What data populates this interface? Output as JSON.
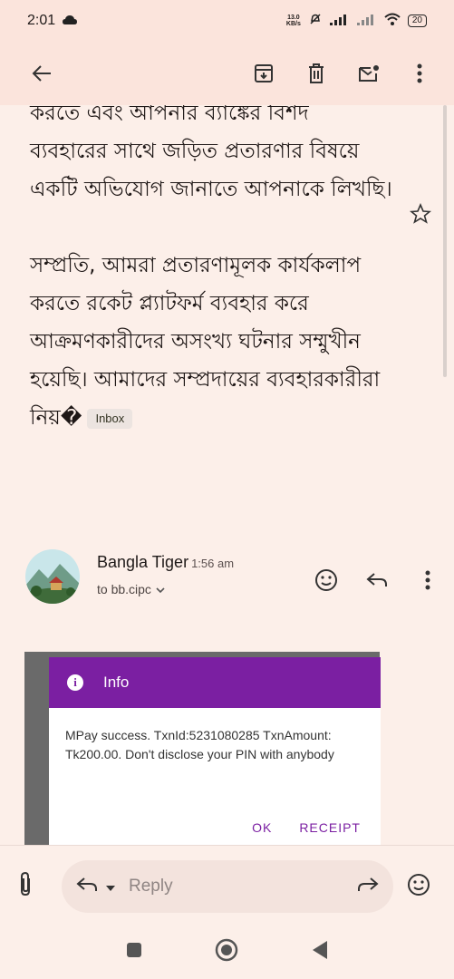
{
  "status": {
    "time": "2:01",
    "net_speed_value": "13.0",
    "net_speed_unit": "KB/s",
    "battery": "20"
  },
  "email": {
    "paragraphs": [
      "করতে এবং আপনার ব্যাঙ্কের বিশদ ব্যবহারের সাথে জড়িত প্রতারণার বিষয়ে একটি অভিযোগ জানাতে আপনাকে লিখছি।",
      "সম্প্রতি, আমরা প্রতারণামূলক কার্যকলাপ করতে রকেট প্ল্যাটফর্ম ব্যবহার করে আক্রমণকারীদের অসংখ্য ঘটনার সম্মুখীন হয়েছি। আমাদের সম্প্রদায়ের ব্যবহারকারীরা নিয়�"
    ],
    "label_chip": "Inbox"
  },
  "sender": {
    "name": "Bangla Tiger",
    "time": "1:56 am",
    "to": "to bb.cipc"
  },
  "dialog": {
    "title": "Info",
    "message": "MPay success. TxnId:5231080285 TxnAmount: Tk200.00. Don't disclose your PIN with anybody",
    "ok": "OK",
    "receipt": "RECEIPT"
  },
  "reply": {
    "placeholder": "Reply"
  },
  "colors": {
    "background": "#fcefe9",
    "top_bar": "#fbe4dc",
    "dialog_accent": "#7b1fa2"
  }
}
